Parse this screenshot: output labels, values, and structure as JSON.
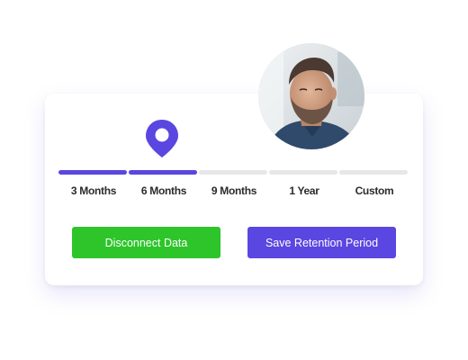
{
  "colors": {
    "accent": "#5a46e0",
    "green": "#2dc52a",
    "inactive_track": "#e7e7ea",
    "text": "#2b2b2b"
  },
  "slider": {
    "selected_index": 1,
    "selected_label": "6 Months",
    "options": [
      {
        "label": "3 Months",
        "active": true
      },
      {
        "label": "6 Months",
        "active": true
      },
      {
        "label": "9 Months",
        "active": false
      },
      {
        "label": "1 Year",
        "active": false
      },
      {
        "label": "Custom",
        "active": false
      }
    ]
  },
  "icons": {
    "marker": "map-pin-icon",
    "profile": "user-avatar-photo"
  },
  "buttons": {
    "disconnect_label": "Disconnect Data",
    "save_label": "Save Retention Period"
  }
}
